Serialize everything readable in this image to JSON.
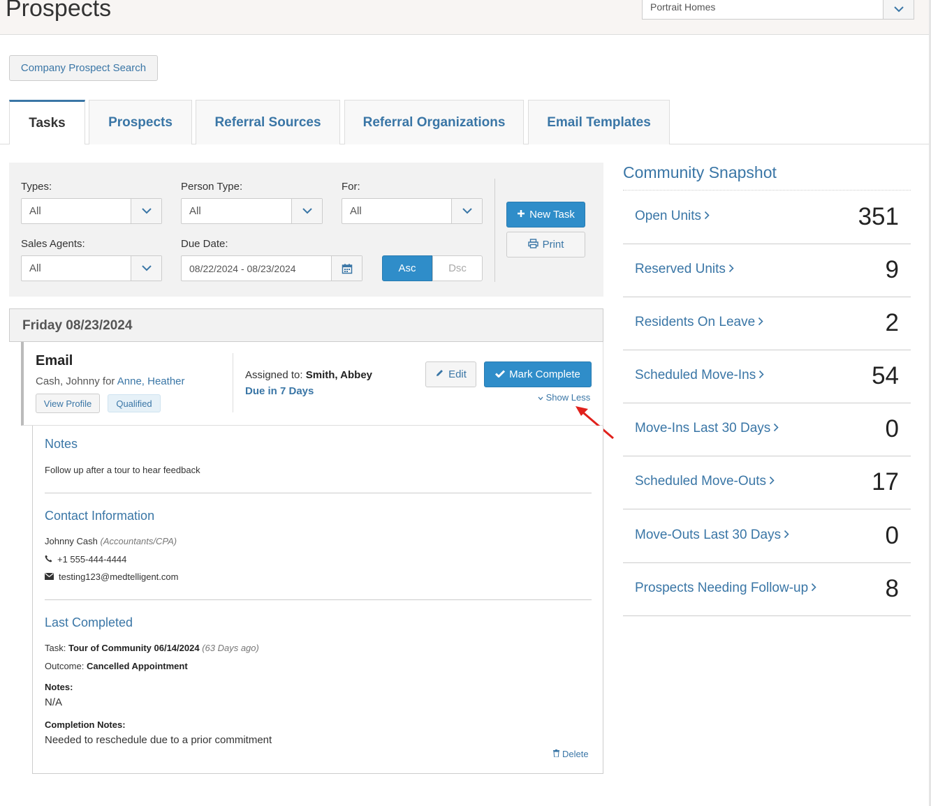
{
  "header": {
    "title": "Prospects",
    "community": "Portrait Homes"
  },
  "buttons": {
    "company_search": "Company Prospect Search",
    "new_task": "New Task",
    "print": "Print",
    "asc": "Asc",
    "dsc": "Dsc",
    "edit": "Edit",
    "mark_complete": "Mark Complete",
    "show_less": "Show Less",
    "view_profile": "View Profile",
    "delete": "Delete"
  },
  "tabs": [
    {
      "label": "Tasks",
      "active": true
    },
    {
      "label": "Prospects"
    },
    {
      "label": "Referral Sources"
    },
    {
      "label": "Referral Organizations"
    },
    {
      "label": "Email Templates"
    }
  ],
  "filters": {
    "types_label": "Types:",
    "types_value": "All",
    "person_type_label": "Person Type:",
    "person_type_value": "All",
    "for_label": "For:",
    "for_value": "All",
    "sales_agents_label": "Sales Agents:",
    "sales_agents_value": "All",
    "due_date_label": "Due Date:",
    "due_date_value": "08/22/2024 - 08/23/2024"
  },
  "day": {
    "header": "Friday 08/23/2024"
  },
  "task": {
    "title": "Email",
    "person": "Cash, Johnny",
    "for_word": "for",
    "for_link": "Anne, Heather",
    "badge": "Qualified",
    "assigned_label": "Assigned to:",
    "assigned_name": "Smith, Abbey",
    "due": "Due in 7 Days"
  },
  "details": {
    "notes_title": "Notes",
    "notes_text": "Follow up after a tour to hear feedback",
    "contact_title": "Contact Information",
    "contact_name": "Johnny Cash",
    "contact_role": "(Accountants/CPA)",
    "contact_phone": "+1 555-444-4444",
    "contact_email": "testing123@medtelligent.com",
    "last_title": "Last Completed",
    "task_label": "Task:",
    "task_value": "Tour of Community 06/14/2024",
    "task_ago": "(63 Days ago)",
    "outcome_label": "Outcome:",
    "outcome_value": "Cancelled Appointment",
    "notes_label": "Notes:",
    "notes_value": "N/A",
    "completion_label": "Completion Notes:",
    "completion_value": "Needed to reschedule due to a prior commitment"
  },
  "snapshot": {
    "title": "Community Snapshot",
    "rows": [
      {
        "label": "Open Units",
        "value": "351"
      },
      {
        "label": "Reserved Units",
        "value": "9"
      },
      {
        "label": "Residents On Leave",
        "value": "2"
      },
      {
        "label": "Scheduled Move-Ins",
        "value": "54"
      },
      {
        "label": "Move-Ins Last 30 Days",
        "value": "0"
      },
      {
        "label": "Scheduled Move-Outs",
        "value": "17"
      },
      {
        "label": "Move-Outs Last 30 Days",
        "value": "0"
      },
      {
        "label": "Prospects Needing Follow-up",
        "value": "8"
      }
    ]
  },
  "colors": {
    "accent": "#3a76a6",
    "primary_button": "#2f8dc9",
    "annotation_arrow": "#e0211c"
  }
}
